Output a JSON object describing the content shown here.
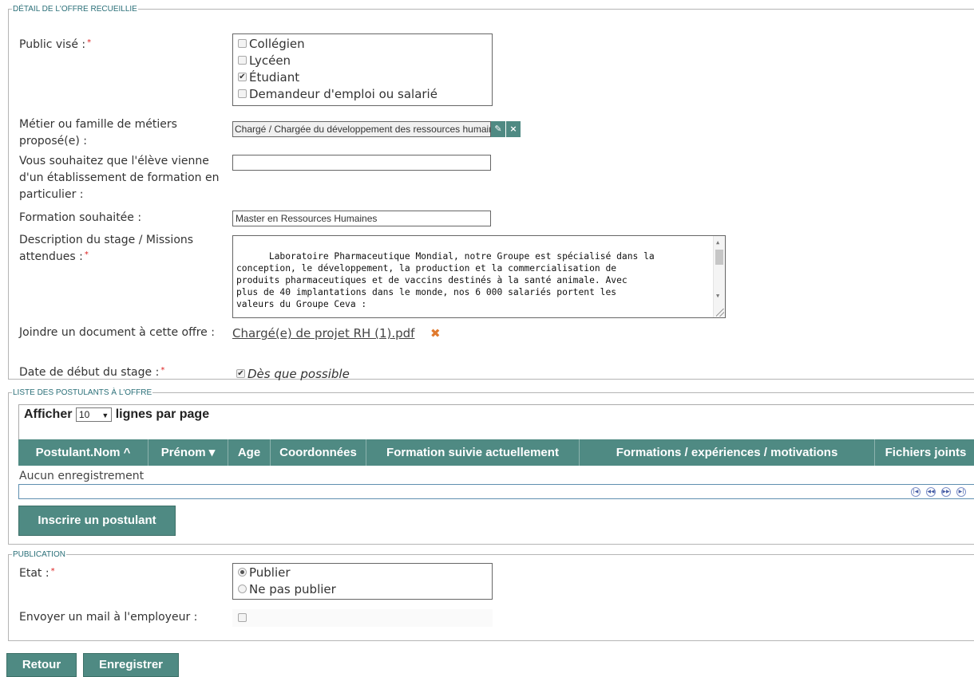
{
  "offer_detail": {
    "legend": "DÉTAIL DE L'OFFRE RECUEILLIE",
    "public_vise": {
      "label": "Public visé :",
      "required_mark": "*",
      "options": [
        {
          "label": "Collégien",
          "checked": false
        },
        {
          "label": "Lycéen",
          "checked": false
        },
        {
          "label": "Étudiant",
          "checked": true
        },
        {
          "label": "Demandeur d'emploi ou salarié",
          "checked": false
        }
      ]
    },
    "metier": {
      "label": "Métier ou famille de métiers proposé(e) :",
      "value": "Chargé / Chargée du développement des ressources humaines",
      "edit_icon": "pencil-icon",
      "clear_icon": "close-icon"
    },
    "etablissement": {
      "label": "Vous souhaitez que l'élève vienne d'un établissement de formation en particulier :",
      "value": ""
    },
    "formation": {
      "label": "Formation souhaitée :",
      "value": "Master en Ressources Humaines"
    },
    "description": {
      "label": "Description du stage / Missions attendues :",
      "required_mark": "*",
      "value": "Laboratoire Pharmaceutique Mondial, notre Groupe est spécialisé dans la\nconception, le développement, la production et la commercialisation de\nproduits pharmaceutiques et de vaccins destinés à la santé animale. Avec\nplus de 40 implantations dans le monde, nos 6 000 salariés portent les\nvaleurs du Groupe Ceva :"
    },
    "document": {
      "label": "Joindre un document à cette offre :",
      "file_name": "Chargé(e) de projet RH (1).pdf",
      "delete_icon": "delete-x-icon"
    },
    "date_debut": {
      "label": "Date de début du stage :",
      "required_mark": "*",
      "asap_label": "Dès que possible",
      "asap_checked": true
    }
  },
  "applicants": {
    "legend": "LISTE DES POSTULANTS À L'OFFRE",
    "afficher_label": "Afficher",
    "page_size": "10",
    "per_page_label": "lignes par page",
    "columns": [
      "Postulant.Nom ^",
      "Prénom ▾",
      "Age",
      "Coordonnées",
      "Formation suivie actuellement",
      "Formations / expériences / motivations",
      "Fichiers joints"
    ],
    "empty_text": "Aucun enregistrement",
    "pager_icons": [
      "first-page-icon",
      "prev-page-icon",
      "next-page-icon",
      "last-page-icon"
    ],
    "add_button": "Inscrire un postulant"
  },
  "publication": {
    "legend": "PUBLICATION",
    "etat_label": "Etat :",
    "required_mark": "*",
    "options": [
      {
        "label": "Publier",
        "selected": true
      },
      {
        "label": "Ne pas publier",
        "selected": false
      }
    ],
    "mail_label": "Envoyer un mail à l'employeur :",
    "mail_checked": false
  },
  "actions": {
    "back": "Retour",
    "save": "Enregistrer"
  },
  "colors": {
    "accent": "#4f8a83",
    "legend": "#2a6f78",
    "required": "#dd2222"
  }
}
